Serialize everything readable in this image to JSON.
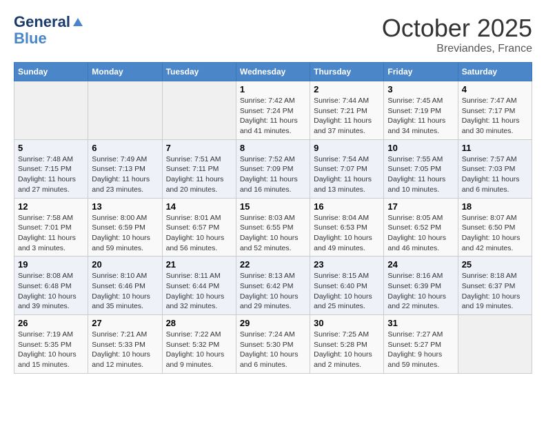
{
  "header": {
    "logo_line1": "General",
    "logo_line2": "Blue",
    "month": "October 2025",
    "location": "Breviandes, France"
  },
  "weekdays": [
    "Sunday",
    "Monday",
    "Tuesday",
    "Wednesday",
    "Thursday",
    "Friday",
    "Saturday"
  ],
  "weeks": [
    [
      {
        "day": "",
        "empty": true
      },
      {
        "day": "",
        "empty": true
      },
      {
        "day": "",
        "empty": true
      },
      {
        "day": "1",
        "sunrise": "7:42 AM",
        "sunset": "7:24 PM",
        "daylight": "11 hours and 41 minutes."
      },
      {
        "day": "2",
        "sunrise": "7:44 AM",
        "sunset": "7:21 PM",
        "daylight": "11 hours and 37 minutes."
      },
      {
        "day": "3",
        "sunrise": "7:45 AM",
        "sunset": "7:19 PM",
        "daylight": "11 hours and 34 minutes."
      },
      {
        "day": "4",
        "sunrise": "7:47 AM",
        "sunset": "7:17 PM",
        "daylight": "11 hours and 30 minutes."
      }
    ],
    [
      {
        "day": "5",
        "sunrise": "7:48 AM",
        "sunset": "7:15 PM",
        "daylight": "11 hours and 27 minutes."
      },
      {
        "day": "6",
        "sunrise": "7:49 AM",
        "sunset": "7:13 PM",
        "daylight": "11 hours and 23 minutes."
      },
      {
        "day": "7",
        "sunrise": "7:51 AM",
        "sunset": "7:11 PM",
        "daylight": "11 hours and 20 minutes."
      },
      {
        "day": "8",
        "sunrise": "7:52 AM",
        "sunset": "7:09 PM",
        "daylight": "11 hours and 16 minutes."
      },
      {
        "day": "9",
        "sunrise": "7:54 AM",
        "sunset": "7:07 PM",
        "daylight": "11 hours and 13 minutes."
      },
      {
        "day": "10",
        "sunrise": "7:55 AM",
        "sunset": "7:05 PM",
        "daylight": "11 hours and 10 minutes."
      },
      {
        "day": "11",
        "sunrise": "7:57 AM",
        "sunset": "7:03 PM",
        "daylight": "11 hours and 6 minutes."
      }
    ],
    [
      {
        "day": "12",
        "sunrise": "7:58 AM",
        "sunset": "7:01 PM",
        "daylight": "11 hours and 3 minutes."
      },
      {
        "day": "13",
        "sunrise": "8:00 AM",
        "sunset": "6:59 PM",
        "daylight": "10 hours and 59 minutes."
      },
      {
        "day": "14",
        "sunrise": "8:01 AM",
        "sunset": "6:57 PM",
        "daylight": "10 hours and 56 minutes."
      },
      {
        "day": "15",
        "sunrise": "8:03 AM",
        "sunset": "6:55 PM",
        "daylight": "10 hours and 52 minutes."
      },
      {
        "day": "16",
        "sunrise": "8:04 AM",
        "sunset": "6:53 PM",
        "daylight": "10 hours and 49 minutes."
      },
      {
        "day": "17",
        "sunrise": "8:05 AM",
        "sunset": "6:52 PM",
        "daylight": "10 hours and 46 minutes."
      },
      {
        "day": "18",
        "sunrise": "8:07 AM",
        "sunset": "6:50 PM",
        "daylight": "10 hours and 42 minutes."
      }
    ],
    [
      {
        "day": "19",
        "sunrise": "8:08 AM",
        "sunset": "6:48 PM",
        "daylight": "10 hours and 39 minutes."
      },
      {
        "day": "20",
        "sunrise": "8:10 AM",
        "sunset": "6:46 PM",
        "daylight": "10 hours and 35 minutes."
      },
      {
        "day": "21",
        "sunrise": "8:11 AM",
        "sunset": "6:44 PM",
        "daylight": "10 hours and 32 minutes."
      },
      {
        "day": "22",
        "sunrise": "8:13 AM",
        "sunset": "6:42 PM",
        "daylight": "10 hours and 29 minutes."
      },
      {
        "day": "23",
        "sunrise": "8:15 AM",
        "sunset": "6:40 PM",
        "daylight": "10 hours and 25 minutes."
      },
      {
        "day": "24",
        "sunrise": "8:16 AM",
        "sunset": "6:39 PM",
        "daylight": "10 hours and 22 minutes."
      },
      {
        "day": "25",
        "sunrise": "8:18 AM",
        "sunset": "6:37 PM",
        "daylight": "10 hours and 19 minutes."
      }
    ],
    [
      {
        "day": "26",
        "sunrise": "7:19 AM",
        "sunset": "5:35 PM",
        "daylight": "10 hours and 15 minutes."
      },
      {
        "day": "27",
        "sunrise": "7:21 AM",
        "sunset": "5:33 PM",
        "daylight": "10 hours and 12 minutes."
      },
      {
        "day": "28",
        "sunrise": "7:22 AM",
        "sunset": "5:32 PM",
        "daylight": "10 hours and 9 minutes."
      },
      {
        "day": "29",
        "sunrise": "7:24 AM",
        "sunset": "5:30 PM",
        "daylight": "10 hours and 6 minutes."
      },
      {
        "day": "30",
        "sunrise": "7:25 AM",
        "sunset": "5:28 PM",
        "daylight": "10 hours and 2 minutes."
      },
      {
        "day": "31",
        "sunrise": "7:27 AM",
        "sunset": "5:27 PM",
        "daylight": "9 hours and 59 minutes."
      },
      {
        "day": "",
        "empty": true
      }
    ]
  ],
  "labels": {
    "sunrise": "Sunrise:",
    "sunset": "Sunset:",
    "daylight": "Daylight:"
  }
}
